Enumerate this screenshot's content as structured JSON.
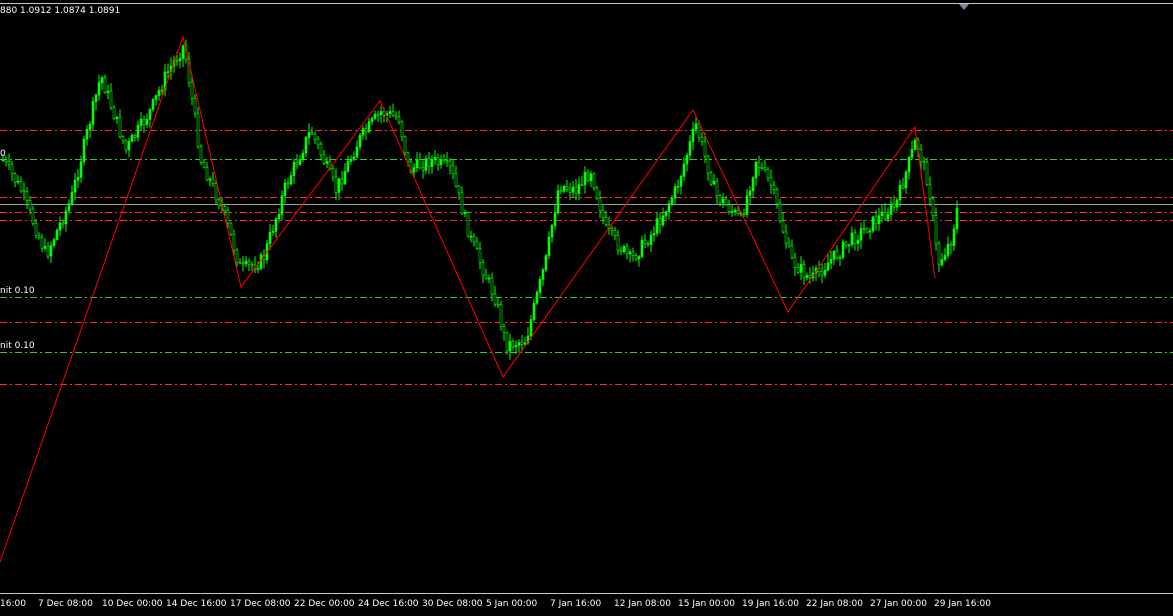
{
  "header": {
    "ohlc_text": "880 1.0912 1.0874 1.0891"
  },
  "levels": {
    "label_upper": "nit 0.10",
    "label_lower": "nit 0.10",
    "label_stub": "0",
    "color_red": "#ff2a2a",
    "color_green": "#2fcc2f",
    "color_price_line": "#9a9a9a"
  },
  "time_axis": {
    "labels": [
      "16:00",
      "7 Dec 08:00",
      "10 Dec 00:00",
      "14 Dec 16:00",
      "17 Dec 08:00",
      "22 Dec 00:00",
      "24 Dec 16:00",
      "30 Dec 08:00",
      "5 Jan 00:00",
      "7 Jan 16:00",
      "12 Jan 08:00",
      "15 Jan 00:00",
      "19 Jan 16:00",
      "22 Jan 08:00",
      "27 Jan 00:00",
      "29 Jan 16:00"
    ]
  },
  "colors": {
    "background": "#000000",
    "candle": "#00ff00",
    "zigzag": "#ff0000",
    "text": "#ffffff"
  }
}
